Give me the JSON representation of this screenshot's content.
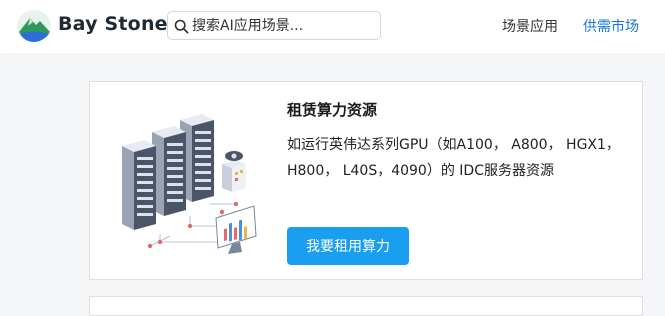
{
  "header": {
    "brand_name": "Bay Stone",
    "logo_icon": "bay-stone-mountain-logo",
    "search": {
      "placeholder": "搜索AI应用场景...",
      "icon": "search-icon"
    },
    "nav": [
      {
        "label": "场景应用"
      },
      {
        "label": "供需市场"
      }
    ]
  },
  "card": {
    "title": "租赁算力资源",
    "description": "如运行英伟达系列GPU（如A100， A800， HGX1， H800， L40S，4090）的 IDC服务器资源",
    "button_label": "我要租用算力",
    "illustration_icon": "server-rack-illustration"
  },
  "colors": {
    "accent": "#1a9ff0",
    "nav_active": "#1677d6",
    "logo_green": "#2e9a5a",
    "logo_blue": "#2b6fd6",
    "page_bg": "#f5f6f8"
  }
}
